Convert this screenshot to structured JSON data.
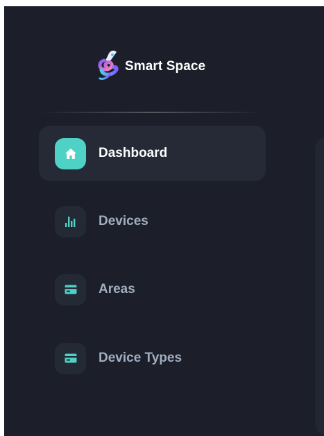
{
  "app": {
    "title": "Smart Space",
    "logo_icon": "rocket-swirl-icon"
  },
  "sidebar": {
    "items": [
      {
        "label": "Dashboard",
        "icon": "home-icon",
        "active": true
      },
      {
        "label": "Devices",
        "icon": "bar-chart-icon",
        "active": false
      },
      {
        "label": "Areas",
        "icon": "credit-card-icon",
        "active": false
      },
      {
        "label": "Device Types",
        "icon": "credit-card-icon",
        "active": false
      }
    ]
  },
  "colors": {
    "sidebar_bg": "#1c1f29",
    "accent": "#4fd1c5",
    "active_item_bg": "#252a36",
    "inactive_text": "#a0aec0"
  }
}
